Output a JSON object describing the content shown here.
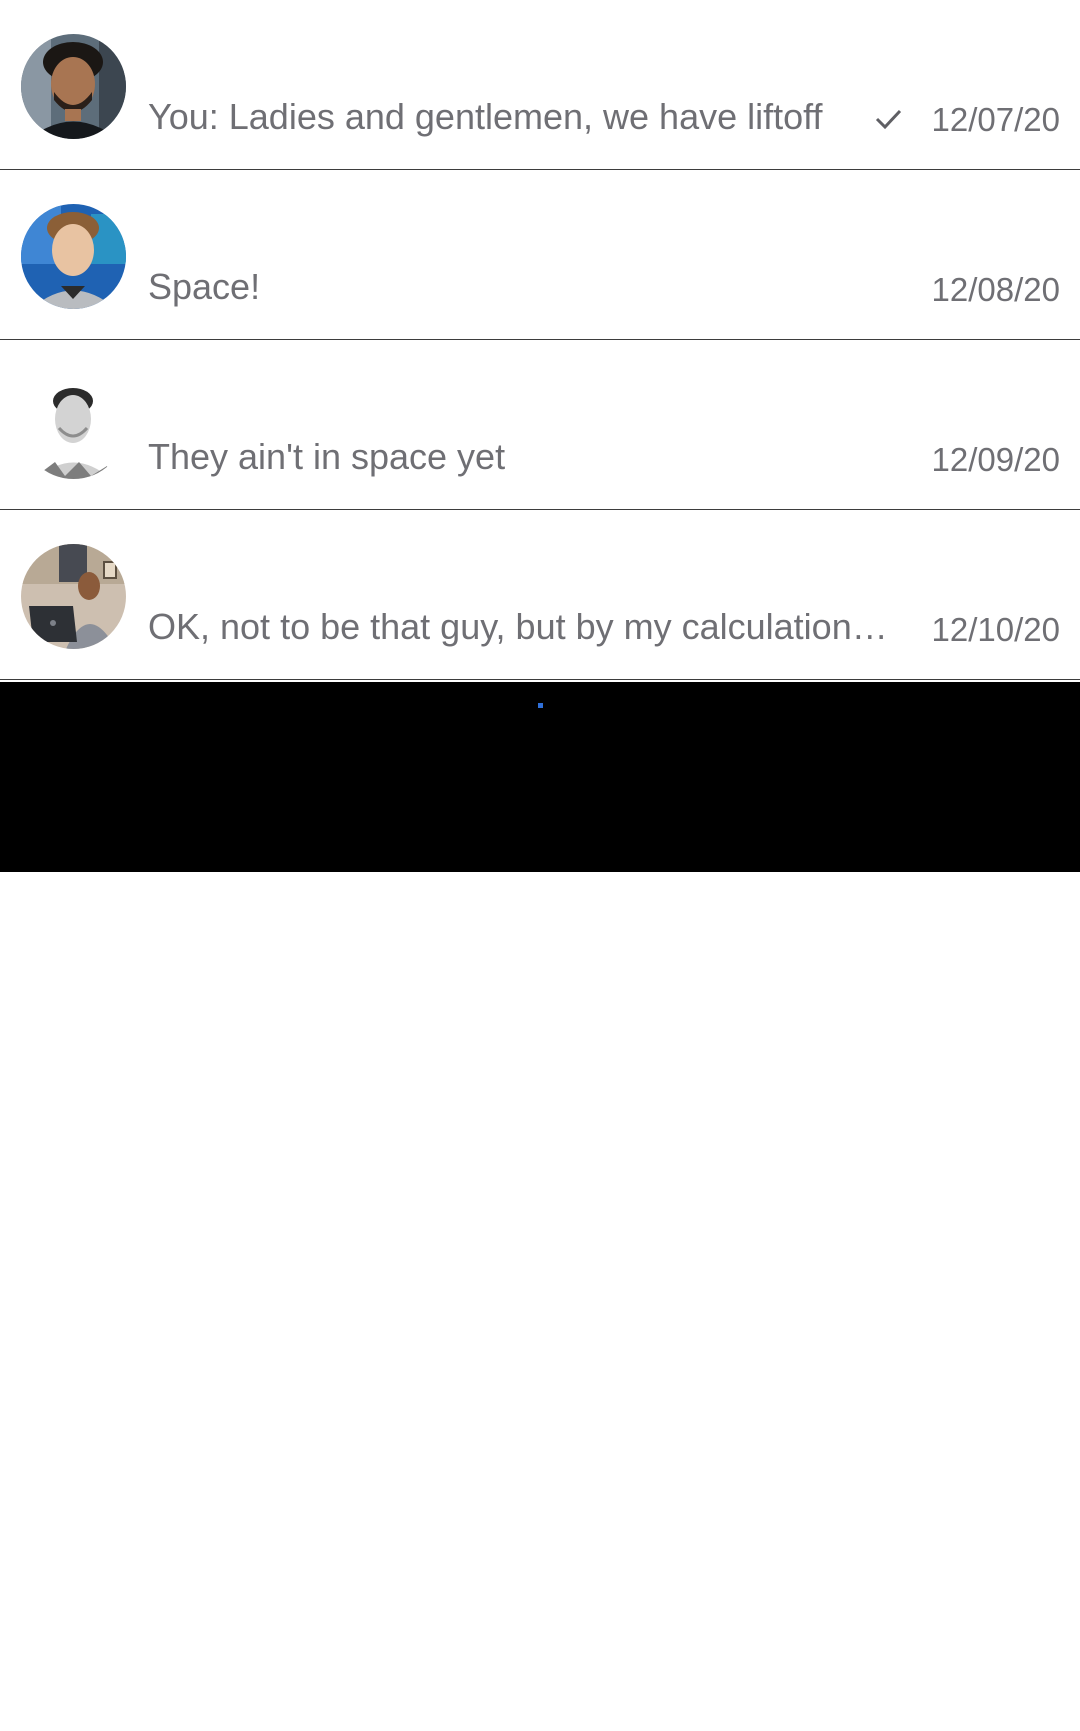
{
  "conversations": [
    {
      "avatar": "avatar-man-dark-hair-beard",
      "preview": "You: Ladies and gentlemen, we have liftoff",
      "sent_status": "check-icon",
      "date": "12/07/20"
    },
    {
      "avatar": "avatar-young-man-blue-background",
      "preview": "Space!",
      "date": "12/08/20"
    },
    {
      "avatar": "avatar-man-black-and-white",
      "preview": "They ain't in space yet",
      "date": "12/09/20"
    },
    {
      "avatar": "avatar-man-with-laptop",
      "preview": "OK, not to be that guy, but by my calculations,...",
      "date": "12/10/20"
    }
  ],
  "colors": {
    "text": "#6f6f74",
    "divider": "#3d3d3d",
    "band": "#000000",
    "loader": "#2f6fd8"
  }
}
